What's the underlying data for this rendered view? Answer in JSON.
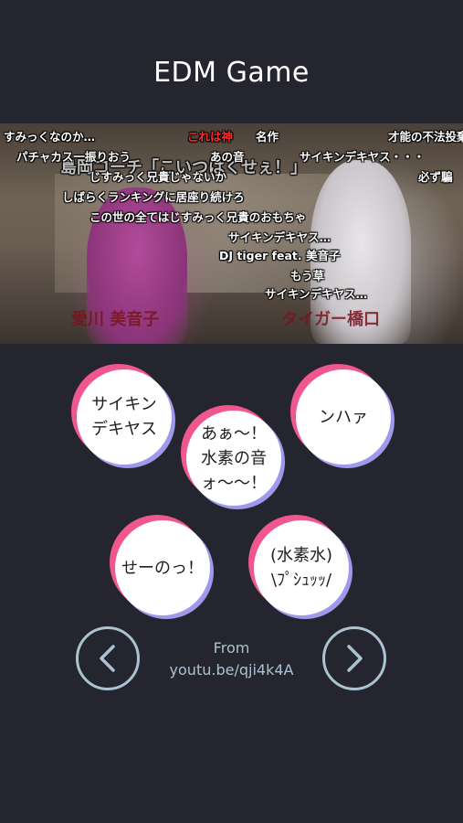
{
  "app": {
    "title": "EDM Game"
  },
  "video": {
    "name_left": "愛川 美音子",
    "name_right": "タイガー橋口",
    "overlay_title": "島岡コーチ「こいつはくせぇ！」",
    "comments": [
      {
        "text": "すみっくなのか…",
        "red": false
      },
      {
        "text": "これは神",
        "red": true
      },
      {
        "text": "名作",
        "red": false
      },
      {
        "text": "才能の不法投棄",
        "red": false
      },
      {
        "text": "パチャカス一振りおう",
        "red": false
      },
      {
        "text": "あの音",
        "red": false
      },
      {
        "text": "サイキンデキヤス・・・",
        "red": false
      },
      {
        "text": "じすみっく兄貴じゃないか",
        "red": false
      },
      {
        "text": "必ず騙",
        "red": false
      },
      {
        "text": "しばらくランキングに居座り続けろ",
        "red": false
      },
      {
        "text": "この世の全てはじすみっく兄貴のおもちゃ",
        "red": false
      },
      {
        "text": "サイキンデキヤス…",
        "red": false
      },
      {
        "text": "DJ tiger feat. 美音子",
        "red": false
      },
      {
        "text": "もう草",
        "red": false
      },
      {
        "text": "サイキンデキヤス…",
        "red": false
      }
    ]
  },
  "sounds": [
    {
      "label": "サイキン\nデキヤス"
    },
    {
      "label": "あぁ～！\n水素の音\nォ～～！"
    },
    {
      "label": "ンハァ"
    },
    {
      "label": "せーのっ！"
    },
    {
      "label": "(水素水)\n\\ﾌﾟｼｭｯｯ/"
    }
  ],
  "footer": {
    "from_label": "From",
    "source_link": "youtu.be/qji4k4A",
    "prev_icon": "chevron-left-icon",
    "next_icon": "chevron-right-icon"
  },
  "colors": {
    "background": "#24252f",
    "bubble_pink": "#f0578f",
    "bubble_violet": "#9f98eb",
    "nav_outline": "#a9c4d0"
  }
}
